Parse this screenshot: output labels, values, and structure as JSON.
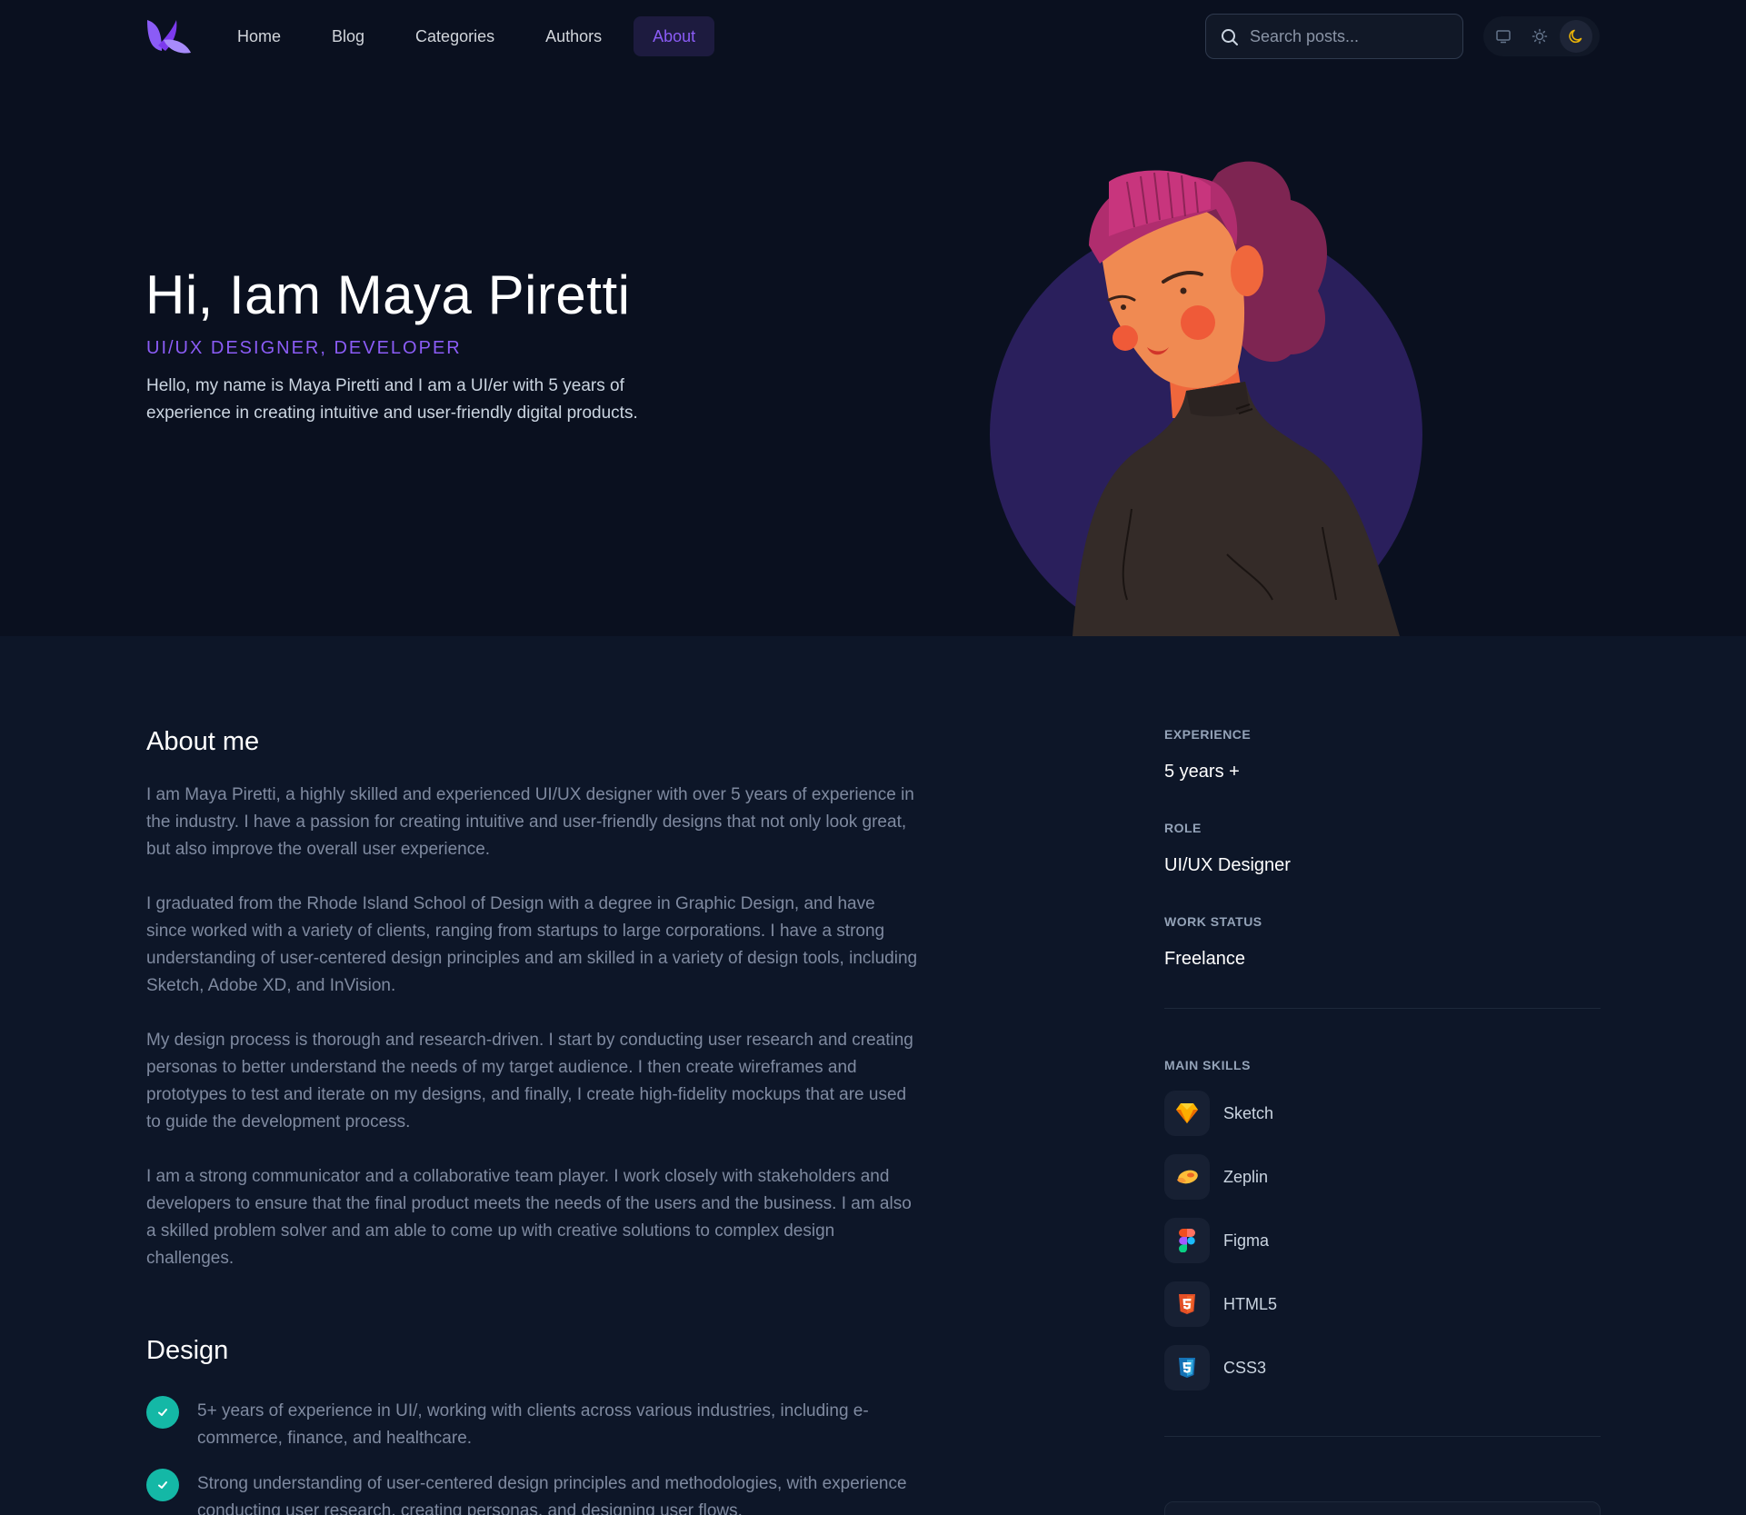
{
  "header": {
    "nav": [
      {
        "label": "Home"
      },
      {
        "label": "Blog"
      },
      {
        "label": "Categories"
      },
      {
        "label": "Authors"
      },
      {
        "label": "About",
        "active": true
      }
    ],
    "search": {
      "placeholder": "Search posts..."
    },
    "theme": {
      "options": [
        "system-icon",
        "sun-icon",
        "moon-icon"
      ],
      "selected": "moon-icon"
    }
  },
  "hero": {
    "title": "Hi, Iam Maya Piretti",
    "subtitle": "UI/UX DESIGNER, DEVELOPER",
    "intro": "Hello, my name is Maya Piretti and I am a UI/er with 5 years of experience in creating intuitive and user-friendly digital products."
  },
  "about": {
    "heading": "About me",
    "paragraphs": [
      "I am Maya Piretti, a highly skilled and experienced UI/UX designer with over 5 years of experience in the industry. I have a passion for creating intuitive and user-friendly designs that not only look great, but also improve the overall user experience.",
      "I graduated from the Rhode Island School of Design with a degree in Graphic Design, and have since worked with a variety of clients, ranging from startups to large corporations. I have a strong understanding of user-centered design principles and am skilled in a variety of design tools, including Sketch, Adobe XD, and InVision.",
      "My design process is thorough and research-driven. I start by conducting user research and creating personas to better understand the needs of my target audience. I then create wireframes and prototypes to test and iterate on my designs, and finally, I create high-fidelity mockups that are used to guide the development process.",
      "I am a strong communicator and a collaborative team player. I work closely with stakeholders and developers to ensure that the final product meets the needs of the users and the business. I am also a skilled problem solver and am able to come up with creative solutions to complex design challenges."
    ]
  },
  "design": {
    "heading": "Design",
    "items": [
      "5+ years of experience in UI/, working with clients across various industries, including e-commerce, finance, and healthcare.",
      "Strong understanding of user-centered design principles and methodologies, with experience conducting user research, creating personas, and designing user flows."
    ]
  },
  "side": {
    "experience": {
      "label": "EXPERIENCE",
      "value": "5 years +"
    },
    "role": {
      "label": "ROLE",
      "value": "UI/UX Designer"
    },
    "work_status": {
      "label": "WORK STATUS",
      "value": "Freelance"
    },
    "skills_label": "MAIN SKILLS",
    "skills": [
      {
        "name": "Sketch",
        "icon": "sketch-icon"
      },
      {
        "name": "Zeplin",
        "icon": "zeplin-icon"
      },
      {
        "name": "Figma",
        "icon": "figma-icon"
      },
      {
        "name": "HTML5",
        "icon": "html5-icon"
      },
      {
        "name": "CSS3",
        "icon": "css3-icon"
      }
    ]
  },
  "colors": {
    "accent": "#8b5cf6",
    "check": "#14b8a6",
    "background": "#0d1628",
    "hero_background": "#0a101f"
  }
}
